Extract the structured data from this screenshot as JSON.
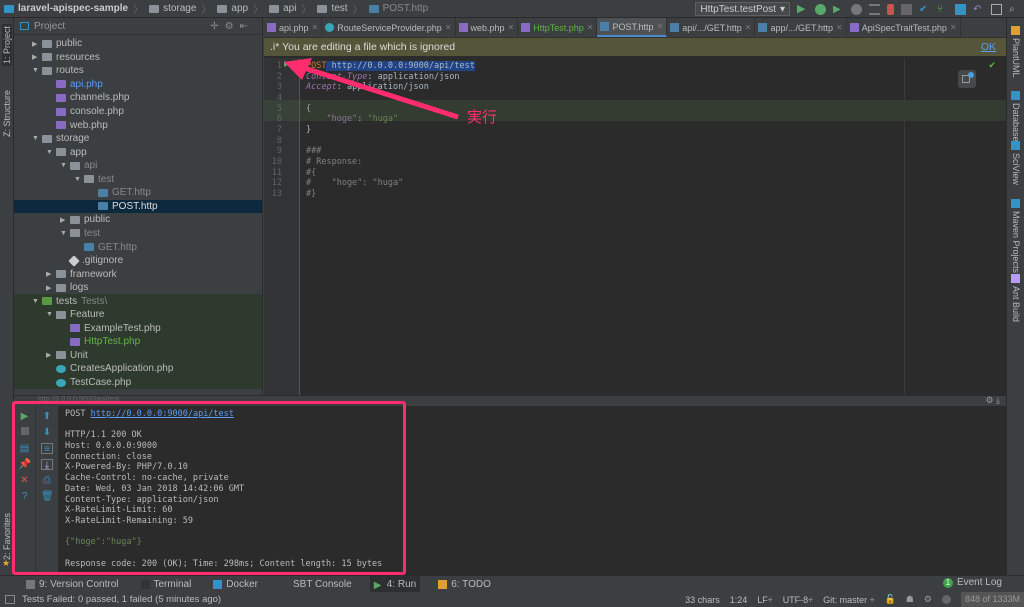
{
  "breadcrumb": [
    "laravel-apispec-sample",
    "storage",
    "app",
    "api",
    "test",
    "POST.http"
  ],
  "toolbar": {
    "run_config": "HttpTest.testPost",
    "icons": [
      "run-icon",
      "debug-icon",
      "coverage-icon",
      "profile-icon",
      "build-icon",
      "stop-icon",
      "vcs-update-icon",
      "vcs-commit-icon",
      "vcs-compare-icon",
      "revert-icon",
      "structure-icon",
      "search-icon"
    ]
  },
  "left_strip": {
    "project": "1: Project",
    "structure": "Z: Structure",
    "favorites": "2: Favorites"
  },
  "right_strip": [
    "PlantUML",
    "Database",
    "SciView",
    "Maven Projects",
    "Ant Build"
  ],
  "project_panel": {
    "title": "Project",
    "tree": [
      {
        "label": "public",
        "level": 0,
        "type": "folder",
        "arrow": "right"
      },
      {
        "label": "resources",
        "level": 0,
        "type": "folder",
        "arrow": "right"
      },
      {
        "label": "routes",
        "level": 0,
        "type": "folder",
        "arrow": "down"
      },
      {
        "label": "api.php",
        "level": 1,
        "type": "php",
        "color": "#589df6"
      },
      {
        "label": "channels.php",
        "level": 1,
        "type": "php"
      },
      {
        "label": "console.php",
        "level": 1,
        "type": "php"
      },
      {
        "label": "web.php",
        "level": 1,
        "type": "php"
      },
      {
        "label": "storage",
        "level": 0,
        "type": "folder",
        "arrow": "down"
      },
      {
        "label": "app",
        "level": 1,
        "type": "folder",
        "arrow": "down"
      },
      {
        "label": "api",
        "level": 2,
        "type": "folder",
        "arrow": "down",
        "color": "#888"
      },
      {
        "label": "test",
        "level": 3,
        "type": "folder",
        "arrow": "down",
        "color": "#888"
      },
      {
        "label": "GET.http",
        "level": 4,
        "type": "http",
        "color": "#888"
      },
      {
        "label": "POST.http",
        "level": 4,
        "type": "http",
        "selected": true,
        "color": "#ddd"
      },
      {
        "label": "public",
        "level": 2,
        "type": "folder",
        "arrow": "right"
      },
      {
        "label": "test",
        "level": 2,
        "type": "folder",
        "arrow": "down",
        "color": "#888"
      },
      {
        "label": "GET.http",
        "level": 3,
        "type": "http",
        "color": "#888"
      },
      {
        "label": ".gitignore",
        "level": 2,
        "type": "git"
      },
      {
        "label": "framework",
        "level": 1,
        "type": "folder",
        "arrow": "right"
      },
      {
        "label": "logs",
        "level": 1,
        "type": "folder",
        "arrow": "right"
      },
      {
        "label": "tests",
        "suffix": "Tests\\",
        "level": 0,
        "type": "testfolder",
        "arrow": "down",
        "green": true
      },
      {
        "label": "Feature",
        "level": 1,
        "type": "folder",
        "arrow": "down",
        "green": true
      },
      {
        "label": "ExampleTest.php",
        "level": 2,
        "type": "php",
        "green": true
      },
      {
        "label": "HttpTest.php",
        "level": 2,
        "type": "php",
        "green": true,
        "color": "#62b543"
      },
      {
        "label": "Unit",
        "level": 1,
        "type": "folder",
        "arrow": "right",
        "green": true
      },
      {
        "label": "CreatesApplication.php",
        "level": 1,
        "type": "class",
        "green": true
      },
      {
        "label": "TestCase.php",
        "level": 1,
        "type": "class",
        "green": true
      }
    ]
  },
  "tabs": [
    {
      "label": "api.php"
    },
    {
      "label": "RouteServiceProvider.php"
    },
    {
      "label": "web.php"
    },
    {
      "label": "HttpTest.php",
      "highlight": true
    },
    {
      "label": "POST.http",
      "active": true
    },
    {
      "label": "api/.../GET.http"
    },
    {
      "label": "app/.../GET.http"
    },
    {
      "label": "ApiSpecTraitTest.php"
    }
  ],
  "banner": {
    "text": ".i* You are editing a file which is ignored",
    "ok": "OK"
  },
  "code_lines": [
    [
      [
        "kw",
        "POST"
      ],
      [
        "url",
        " http://0.0.0.0:9000/api/test"
      ]
    ],
    [
      [
        "hdr",
        "Content-Type"
      ],
      [
        "",
        "： application/json"
      ]
    ],
    [
      [
        "hdr",
        "Accept"
      ],
      [
        "",
        ": application/json"
      ]
    ],
    [],
    [
      [
        "",
        "{"
      ]
    ],
    [
      [
        "",
        "    "
      ],
      [
        "key",
        "\"hoge\""
      ],
      [
        "",
        ": "
      ],
      [
        "str",
        "\"huga\""
      ]
    ],
    [
      [
        "",
        "}"
      ]
    ],
    [],
    [
      [
        "cm",
        "###"
      ]
    ],
    [
      [
        "cm",
        "# Response:"
      ]
    ],
    [
      [
        "cm",
        "#{"
      ]
    ],
    [
      [
        "cm",
        "#    \"hoge\": \"huga\""
      ]
    ],
    [
      [
        "cm",
        "#}"
      ]
    ]
  ],
  "annotation": {
    "label": "実行",
    "color": "#ff2d6e"
  },
  "run": {
    "header": "http://0.0.0.0:9000/api/test",
    "request_method": "POST",
    "request_url": "http://0.0.0.0:9000/api/test",
    "response_headers": [
      "HTTP/1.1 200 OK",
      "Host: 0.0.0.0:9000",
      "Connection: close",
      "X-Powered-By: PHP/7.0.10",
      "Cache-Control: no-cache, private",
      "Date: Wed, 03 Jan 2018 14:42:06 GMT",
      "Content-Type: application/json",
      "X-RateLimit-Limit: 60",
      "X-RateLimit-Remaining: 59"
    ],
    "body": "{\"hoge\":\"huga\"}",
    "summary": "Response code: 200 (OK); Time: 298ms; Content length: 15 bytes"
  },
  "bottom_tabs": [
    {
      "label": "9: Version Control"
    },
    {
      "label": "Terminal"
    },
    {
      "label": "Docker"
    },
    {
      "label": "SBT Console"
    },
    {
      "label": "4: Run",
      "active": true
    },
    {
      "label": "6: TODO"
    }
  ],
  "event_log": {
    "count": "1",
    "label": "Event Log"
  },
  "status": {
    "message": "Tests Failed: 0 passed, 1 failed (5 minutes ago)",
    "chars": "33 chars",
    "position": "1:24",
    "line_sep": "LF÷",
    "encoding": "UTF-8÷",
    "git": "Git: master ÷",
    "memory": "848 of 1333M"
  }
}
